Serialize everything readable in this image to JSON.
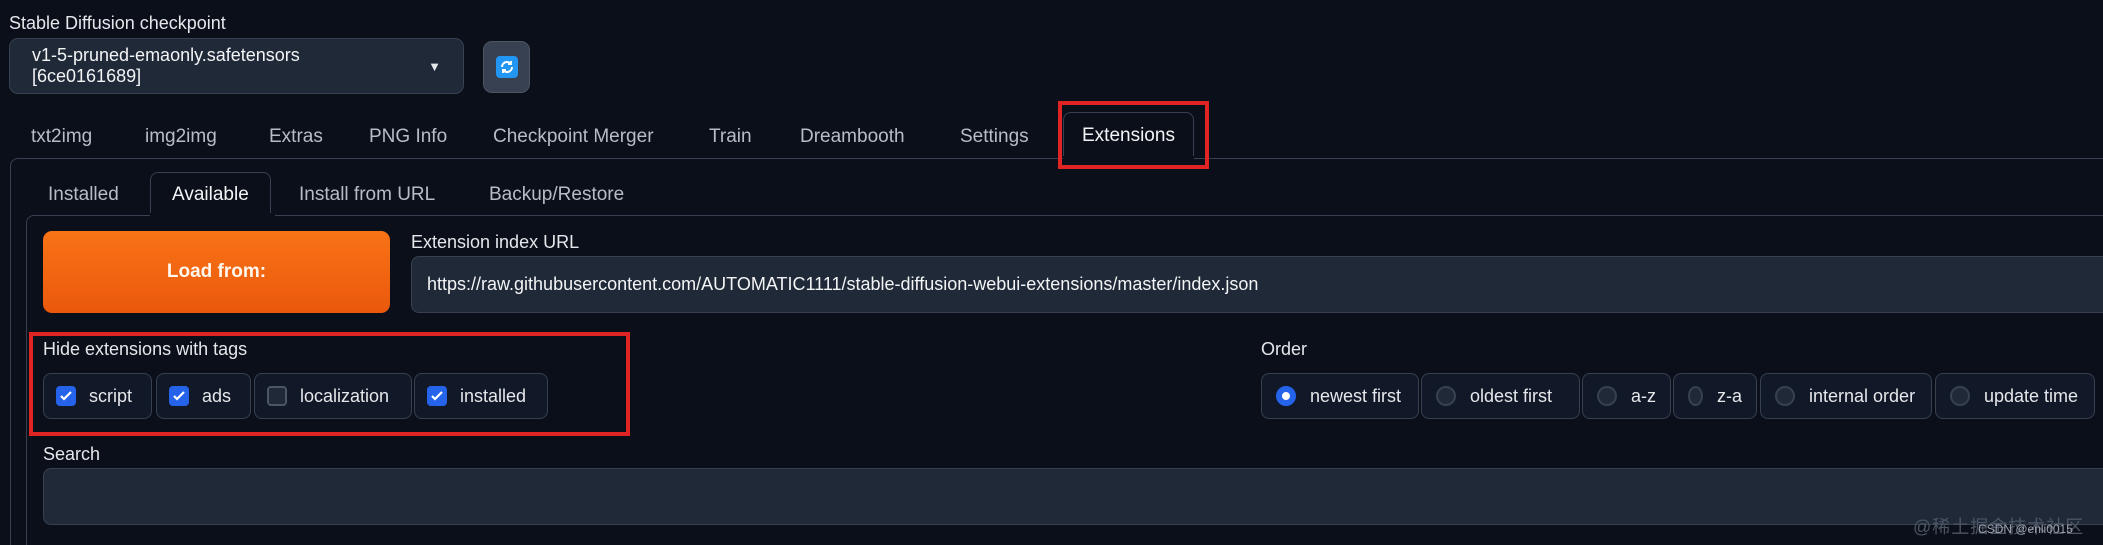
{
  "checkpoint": {
    "label": "Stable Diffusion checkpoint",
    "value": "v1-5-pruned-emaonly.safetensors [6ce0161689]",
    "refresh_icon": "refresh-icon"
  },
  "main_tabs": [
    "txt2img",
    "img2img",
    "Extras",
    "PNG Info",
    "Checkpoint Merger",
    "Train",
    "Dreambooth",
    "Settings",
    "Extensions"
  ],
  "active_main_tab": "Extensions",
  "sub_tabs": [
    "Installed",
    "Available",
    "Install from URL",
    "Backup/Restore"
  ],
  "active_sub_tab": "Available",
  "load": {
    "button_label": "Load from:",
    "url_label": "Extension index URL",
    "url_value": "https://raw.githubusercontent.com/AUTOMATIC1111/stable-diffusion-webui-extensions/master/index.json"
  },
  "hide_tags": {
    "label": "Hide extensions with tags",
    "options": [
      {
        "label": "script",
        "checked": true
      },
      {
        "label": "ads",
        "checked": true
      },
      {
        "label": "localization",
        "checked": false
      },
      {
        "label": "installed",
        "checked": true
      }
    ]
  },
  "order": {
    "label": "Order",
    "options": [
      {
        "label": "newest first",
        "selected": true
      },
      {
        "label": "oldest first",
        "selected": false
      },
      {
        "label": "a-z",
        "selected": false
      },
      {
        "label": "z-a",
        "selected": false
      },
      {
        "label": "internal order",
        "selected": false
      },
      {
        "label": "update time",
        "selected": false
      }
    ]
  },
  "search": {
    "label": "Search",
    "value": ""
  },
  "watermark": {
    "text": "@稀土掘金技术社区",
    "text2": "CSDN @enli0015"
  },
  "colors": {
    "accent": "#2563eb",
    "load_button": "#f97316",
    "highlight": "#e02424",
    "background": "#0b0f19"
  }
}
